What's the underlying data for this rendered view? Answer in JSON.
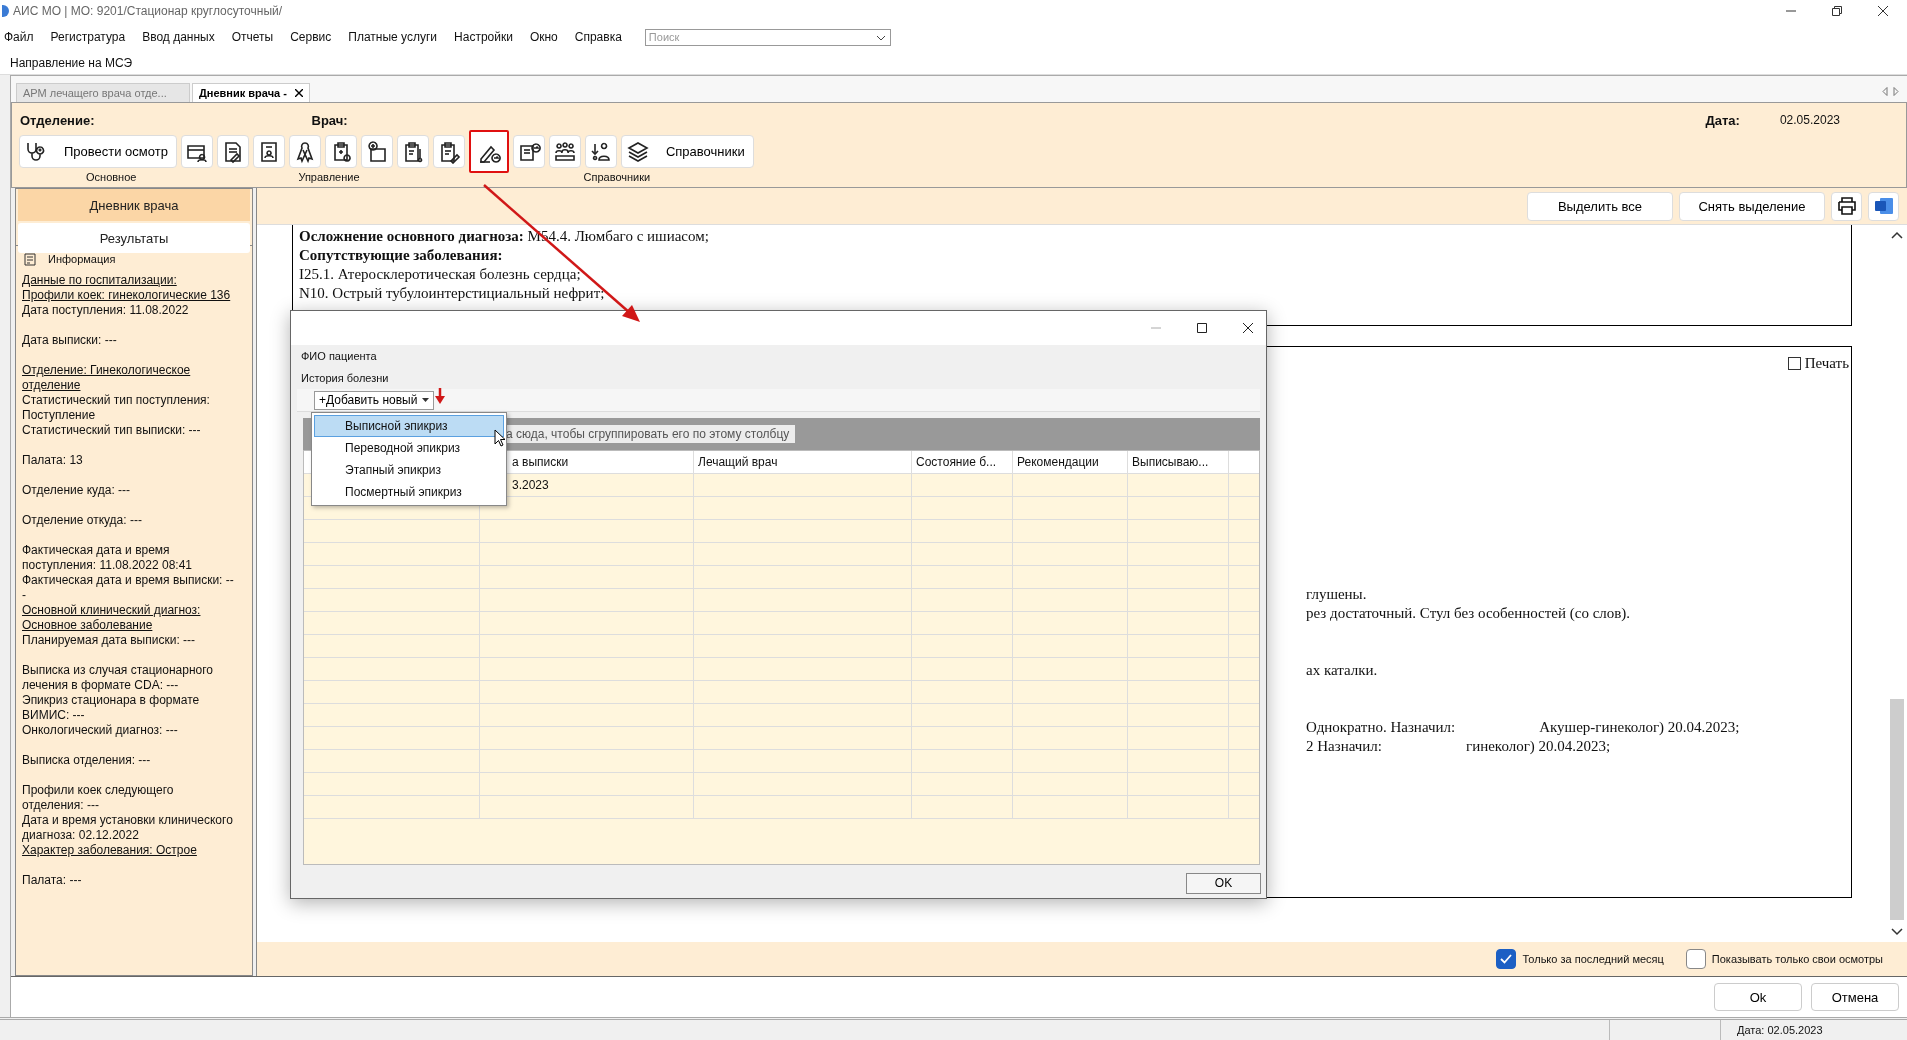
{
  "window": {
    "title": "АИС МО | МО: 9201/Стационар круглосуточный/"
  },
  "menu": [
    "Файл",
    "Регистратура",
    "Ввод данных",
    "Отчеты",
    "Сервис",
    "Платные услуги",
    "Настройки",
    "Окно",
    "Справка"
  ],
  "search": {
    "placeholder": "Поиск"
  },
  "subtoolbar": {
    "label": "Направление на МСЭ"
  },
  "tabs": [
    {
      "label": "АРМ лечащего врача отде...",
      "selected": false,
      "closable": false
    },
    {
      "label": "Дневник врача -",
      "selected": true,
      "closable": true
    }
  ],
  "header": {
    "department_label": "Отделение:",
    "doctor_label": "Врач:",
    "date_label": "Дата:",
    "date": "02.05.2023"
  },
  "toolbar": {
    "exam_button": "Провести осмотр",
    "icon_buttons": [
      {
        "highlighted": false
      },
      {
        "highlighted": false
      },
      {
        "highlighted": false
      },
      {
        "highlighted": false
      },
      {
        "highlighted": false
      },
      {
        "highlighted": false
      },
      {
        "highlighted": false
      },
      {
        "highlighted": false
      },
      {
        "highlighted": true
      },
      {
        "highlighted": false
      },
      {
        "highlighted": false
      },
      {
        "highlighted": false
      }
    ],
    "reference_button": "Справочники",
    "groups": [
      "Основное",
      "Управление",
      "Справочники"
    ]
  },
  "sidebar": {
    "items": [
      {
        "label": "Дневник врача",
        "selected": true
      },
      {
        "label": "Результаты",
        "selected": false
      }
    ],
    "info_title": "Информация",
    "info_blocks": [
      [
        {
          "text": "Данные по госпитализации:",
          "link": true
        },
        {
          "text": "Профили коек: гинекологические 136",
          "link": true
        },
        {
          "text": "Дата поступления: 11.08.2022",
          "link": false
        }
      ],
      [
        {
          "text": "Дата выписки: ---",
          "link": false
        }
      ],
      [
        {
          "text": "Отделение: Гинекологическое отделение",
          "link": true
        },
        {
          "text": "Статистический тип поступления: Поступление",
          "link": false
        },
        {
          "text": "Статистический тип выписки: ---",
          "link": false
        }
      ],
      [
        {
          "text": "Палата: 13",
          "link": false
        }
      ],
      [
        {
          "text": "Отделение куда: ---",
          "link": false
        }
      ],
      [
        {
          "text": "Отделение откуда: ---",
          "link": false
        }
      ],
      [
        {
          "text": "Фактическая дата и время поступления: 11.08.2022 08:41",
          "link": false
        },
        {
          "text": "Фактическая дата и время выписки: ---",
          "link": false
        },
        {
          "text": "Основной клинический диагноз: Основное заболевание",
          "link": true
        },
        {
          "text": "Планируемая дата выписки: ---",
          "link": false
        }
      ],
      [
        {
          "text": "Выписка из случая стационарного лечения в формате CDA: ---",
          "link": false
        },
        {
          "text": "Эпикриз стационара в формате ВИМИС: ---",
          "link": false
        },
        {
          "text": "Онкологический диагноз: ---",
          "link": false
        }
      ],
      [
        {
          "text": "Выписка отделения: ---",
          "link": false
        }
      ],
      [
        {
          "text": "Профили коек следующего отделения: ---",
          "link": false
        },
        {
          "text": "Дата и время установки клинического диагноза: 02.12.2022",
          "link": false
        },
        {
          "text": "Характер заболевания: Острое",
          "link": true
        }
      ],
      [
        {
          "text": "Палата: ---",
          "link": false
        }
      ]
    ]
  },
  "actions": [
    "Выделить все",
    "Снять выделение"
  ],
  "document": {
    "top_lines": [
      "**Осложнение основного диагноза:** М54.4. Люмбаго с ишиасом;",
      "**Сопутствующие заболевания:**",
      "I25.1. Атеросклеротическая болезнь сердца;",
      "N10. Острый тубулоинтерстициальный нефрит;"
    ],
    "print": {
      "label": "Печать",
      "checked": false
    },
    "paragraphs": [
      [
        [
          "глушены."
        ],
        [
          "рез достаточный. Стул без особенностей (со слов)."
        ]
      ],
      [
        [
          "ах каталки."
        ]
      ],
      [
        [
          "Однократно. Назначил:",
          "Акушер-гинеколог) 20.04.2023;"
        ],
        [
          "2 Назначил:",
          "гинеколог) 20.04.2023;"
        ]
      ]
    ]
  },
  "filters": [
    {
      "label": "Только за последний месяц",
      "checked": true
    },
    {
      "label": "Показывать только свои осмотры",
      "checked": false
    }
  ],
  "buttons": [
    "Ok",
    "Отмена"
  ],
  "status_bar": {
    "date": "Дата: 02.05.2023"
  },
  "dialog": {
    "patient_label": "ФИО пациента",
    "history_label": "История болезни",
    "add_button": "+Добавить новый",
    "menu": [
      {
        "label": "Выписной эпикриз",
        "selected": true
      },
      {
        "label": "Переводной эпикриз",
        "selected": false
      },
      {
        "label": "Этапный эпикриз",
        "selected": false
      },
      {
        "label": "Посмертный эпикриз",
        "selected": false
      }
    ],
    "group_hint": "а сюда, чтобы сгруппировать его по этому столбцу",
    "columns": [
      "а выписки",
      "Лечащий врач",
      "Состояние б...",
      "Рекомендации",
      "Выписываю..."
    ],
    "rows": [
      [
        "3.2023"
      ]
    ],
    "ok": "OK"
  }
}
